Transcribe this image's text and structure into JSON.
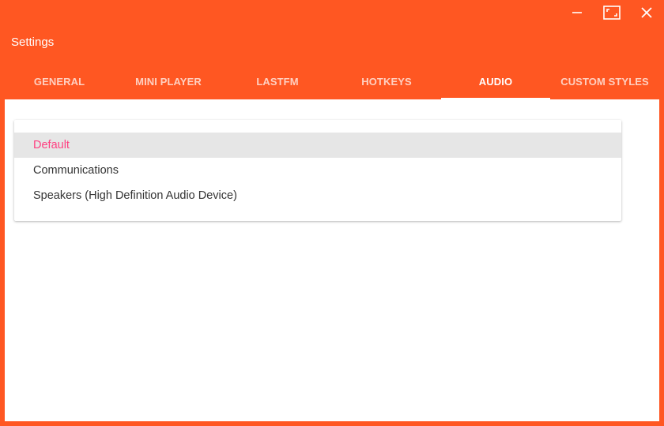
{
  "window": {
    "title": "Settings",
    "controls": {
      "minimize_icon": "minimize-icon",
      "restore_icon": "restore-icon",
      "close_icon": "close-icon"
    }
  },
  "tabs": [
    {
      "label": "GENERAL"
    },
    {
      "label": "MINI PLAYER"
    },
    {
      "label": "LASTFM"
    },
    {
      "label": "HOTKEYS"
    },
    {
      "label": "AUDIO",
      "active": true
    },
    {
      "label": "CUSTOM STYLES"
    }
  ],
  "audio": {
    "devices": [
      {
        "label": "Default",
        "selected": true
      },
      {
        "label": "Communications"
      },
      {
        "label": "Speakers (High Definition Audio Device)"
      }
    ]
  },
  "colors": {
    "accent": "#FF5722",
    "selected_text": "#FF4081",
    "selected_bg": "#e6e6e6"
  }
}
